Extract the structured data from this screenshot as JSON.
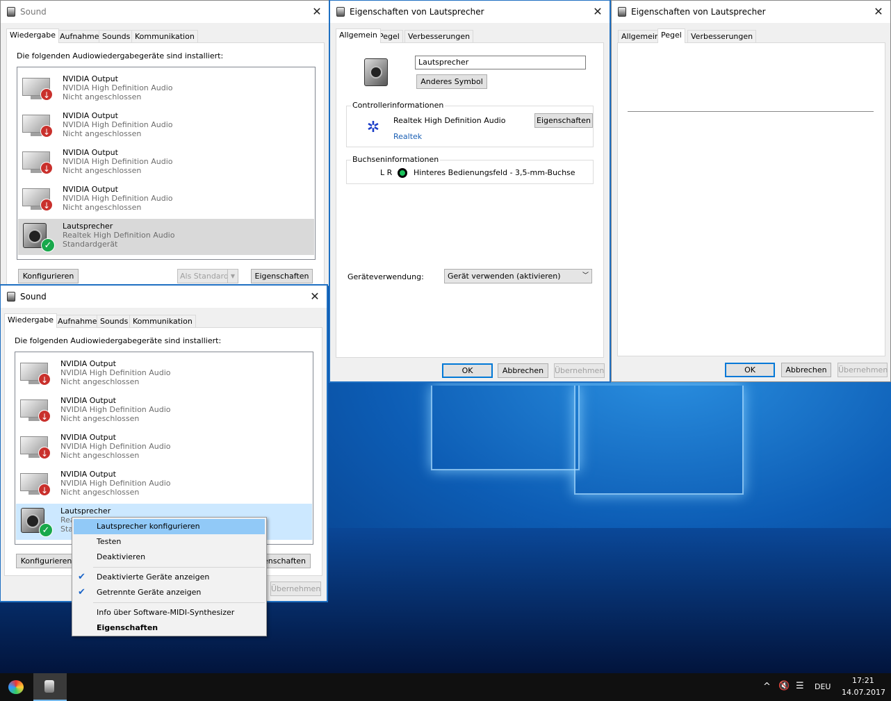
{
  "sound_window_top": {
    "title": "Sound",
    "tabs": [
      "Wiedergabe",
      "Aufnahme",
      "Sounds",
      "Kommunikation"
    ],
    "instruction": "Die folgenden Audiowiedergabegeräte sind installiert:",
    "devices": [
      {
        "name": "NVIDIA Output",
        "driver": "NVIDIA High Definition Audio",
        "status": "Nicht angeschlossen"
      },
      {
        "name": "NVIDIA Output",
        "driver": "NVIDIA High Definition Audio",
        "status": "Nicht angeschlossen"
      },
      {
        "name": "NVIDIA Output",
        "driver": "NVIDIA High Definition Audio",
        "status": "Nicht angeschlossen"
      },
      {
        "name": "NVIDIA Output",
        "driver": "NVIDIA High Definition Audio",
        "status": "Nicht angeschlossen"
      },
      {
        "name": "Lautsprecher",
        "driver": "Realtek High Definition Audio",
        "status": "Standardgerät"
      }
    ],
    "buttons": {
      "configure": "Konfigurieren",
      "set_default": "Als Standard",
      "properties": "Eigenschaften"
    }
  },
  "sound_window_bottom": {
    "title": "Sound",
    "tabs": [
      "Wiedergabe",
      "Aufnahme",
      "Sounds",
      "Kommunikation"
    ],
    "instruction": "Die folgenden Audiowiedergabegeräte sind installiert:",
    "devices": [
      {
        "name": "NVIDIA Output",
        "driver": "NVIDIA High Definition Audio",
        "status": "Nicht angeschlossen"
      },
      {
        "name": "NVIDIA Output",
        "driver": "NVIDIA High Definition Audio",
        "status": "Nicht angeschlossen"
      },
      {
        "name": "NVIDIA Output",
        "driver": "NVIDIA High Definition Audio",
        "status": "Nicht angeschlossen"
      },
      {
        "name": "NVIDIA Output",
        "driver": "NVIDIA High Definition Audio",
        "status": "Nicht angeschlossen"
      },
      {
        "name": "Lautsprecher",
        "driver_partial": "Rea",
        "status_partial": "Sta"
      }
    ],
    "buttons": {
      "configure": "Konfigurieren",
      "properties_partial": "enschaften",
      "apply": "Übernehmen"
    }
  },
  "context_menu": {
    "items": [
      {
        "label": "Lautsprecher konfigurieren",
        "highlighted": true
      },
      {
        "label": "Testen"
      },
      {
        "label": "Deaktivieren"
      },
      {
        "label": "Deaktivierte Geräte anzeigen",
        "checked": true
      },
      {
        "label": "Getrennte Geräte anzeigen",
        "checked": true
      },
      {
        "label": "Info über Software-MIDI-Synthesizer"
      },
      {
        "label": "Eigenschaften",
        "bold": true
      }
    ]
  },
  "props_general": {
    "title": "Eigenschaften von Lautsprecher",
    "tabs": [
      "Allgemein",
      "Pegel",
      "Verbesserungen"
    ],
    "device_name": "Lautsprecher",
    "change_icon": "Anderes Symbol",
    "controller_group": "Controllerinformationen",
    "controller_name": "Realtek High Definition Audio",
    "controller_vendor": "Realtek",
    "controller_props": "Eigenschaften",
    "jack_group": "Buchseninformationen",
    "jack_channels": "L R",
    "jack_desc": "Hinteres Bedienungsfeld - 3,5-mm-Buchse",
    "usage_label": "Geräteverwendung:",
    "usage_value": "Gerät verwenden (aktivieren)",
    "ok": "OK",
    "cancel": "Abbrechen",
    "apply": "Übernehmen"
  },
  "props_levels": {
    "title": "Eigenschaften von Lautsprecher",
    "tabs": [
      "Allgemein",
      "Pegel",
      "Verbesserungen"
    ],
    "ok": "OK",
    "cancel": "Abbrechen",
    "apply": "Übernehmen"
  },
  "taskbar": {
    "language": "DEU",
    "time": "17:21",
    "date": "14.07.2017"
  },
  "colors": {
    "accent": "#0078d7",
    "selection": "#cce8ff",
    "menu_highlight": "#91c9f7"
  }
}
